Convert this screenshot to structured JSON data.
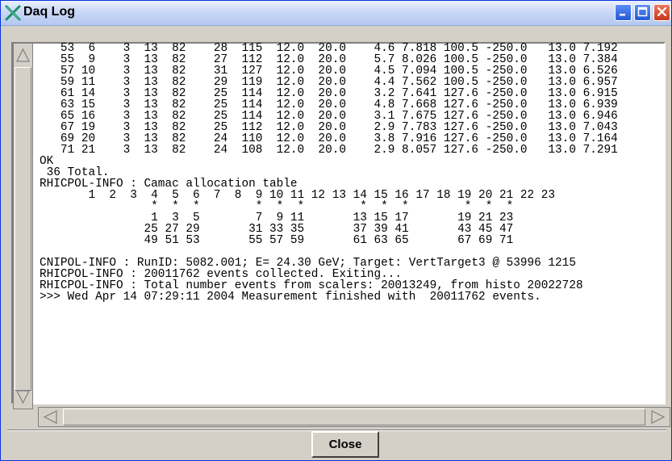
{
  "window": {
    "title": "Daq Log",
    "icon": "x-app-icon",
    "controls": [
      "minimize-icon",
      "maximize-icon",
      "close-icon"
    ]
  },
  "log": {
    "lines": [
      "   53  6    3  13  82    28  115  12.0  20.0    4.6 7.818 100.5 -250.0   13.0 7.192",
      "   55  9    3  13  82    27  112  12.0  20.0    5.7 8.026 100.5 -250.0   13.0 7.384",
      "   57 10    3  13  82    31  127  12.0  20.0    4.5 7.094 100.5 -250.0   13.0 6.526",
      "   59 11    3  13  82    29  119  12.0  20.0    4.4 7.562 100.5 -250.0   13.0 6.957",
      "   61 14    3  13  82    25  114  12.0  20.0    3.2 7.641 127.6 -250.0   13.0 6.915",
      "   63 15    3  13  82    25  114  12.0  20.0    4.8 7.668 127.6 -250.0   13.0 6.939",
      "   65 16    3  13  82    25  114  12.0  20.0    3.1 7.675 127.6 -250.0   13.0 6.946",
      "   67 19    3  13  82    25  112  12.0  20.0    2.9 7.783 127.6 -250.0   13.0 7.043",
      "   69 20    3  13  82    24  110  12.0  20.0    3.8 7.916 127.6 -250.0   13.0 7.164",
      "   71 21    3  13  82    24  108  12.0  20.0    2.9 8.057 127.6 -250.0   13.0 7.291",
      "OK",
      " 36 Total.",
      "RHICPOL-INFO : Camac allocation table",
      "       1  2  3  4  5  6  7  8  9 10 11 12 13 14 15 16 17 18 19 20 21 22 23",
      "                *  *  *        *  *  *        *  *  *        *  *  *",
      "                1  3  5        7  9 11       13 15 17       19 21 23",
      "               25 27 29       31 33 35       37 39 41       43 45 47",
      "               49 51 53       55 57 59       61 63 65       67 69 71",
      "",
      "CNIPOL-INFO : RunID: 5082.001; E= 24.30 GeV; Target: VertTarget3 @ 53996 1215",
      "RHICPOL-INFO : 20011762 events collected. Exiting...",
      "RHICPOL-INFO : Total number events from scalers: 20013249, from histo 20022728",
      ">>> Wed Apr 14 07:29:11 2004 Measurement finished with  20011762 events."
    ]
  },
  "buttons": {
    "close_label": "Close"
  }
}
